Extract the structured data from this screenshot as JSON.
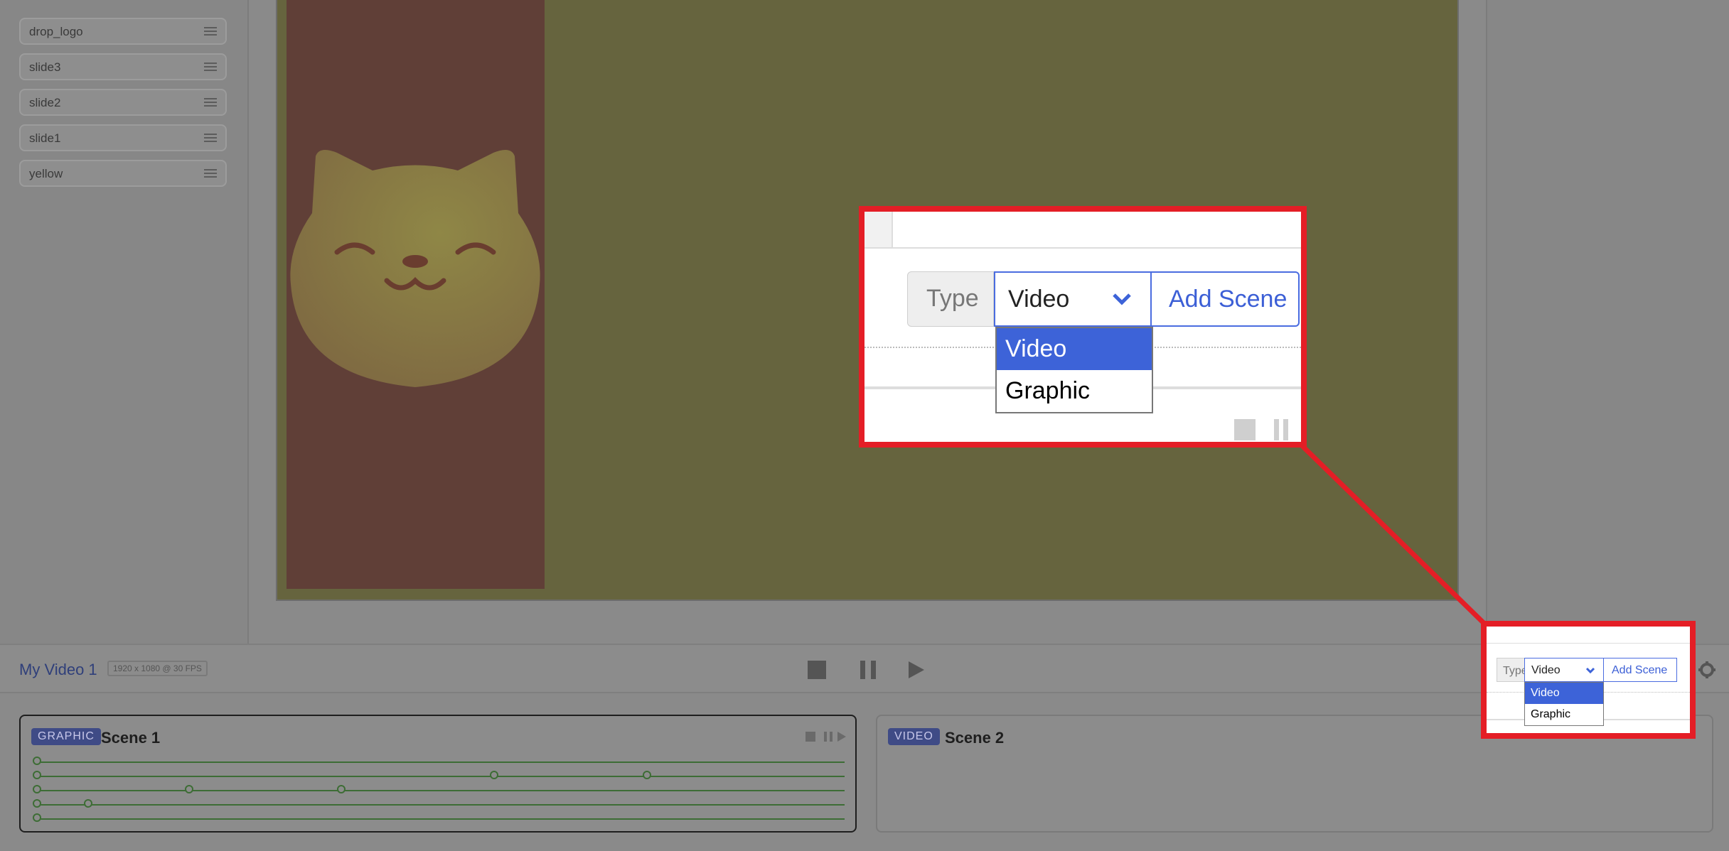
{
  "layers": [
    "drop_logo",
    "slide3",
    "slide2",
    "slide1",
    "yellow"
  ],
  "project": {
    "title": "My Video 1",
    "dims": "1920 x 1080 @ 30 FPS"
  },
  "scenes": [
    {
      "badge": "GRAPHIC",
      "name": "Scene 1"
    },
    {
      "badge": "VIDEO",
      "name": "Scene 2"
    }
  ],
  "add_scene": {
    "type_label": "Type",
    "selected": "Video",
    "button_label": "Add Scene",
    "options": [
      "Video",
      "Graphic"
    ]
  },
  "colors": {
    "stage_background": "#66643e",
    "stage_strip": "#603f37",
    "accent": "#3d63d8",
    "callout_border": "#e41e26"
  }
}
